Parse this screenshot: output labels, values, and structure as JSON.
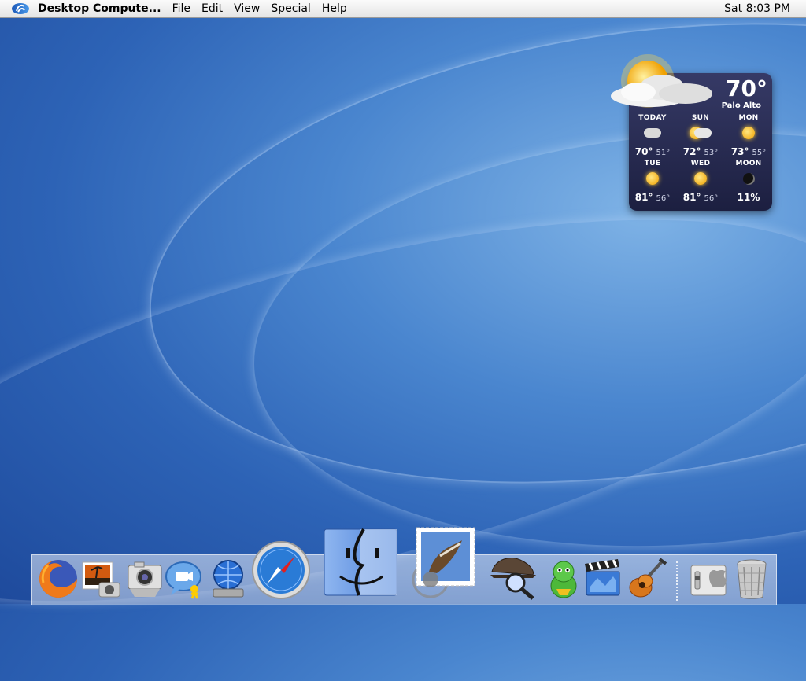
{
  "menubar": {
    "app_name": "Desktop Compute...",
    "menus": [
      "File",
      "Edit",
      "View",
      "Special",
      "Help"
    ],
    "clock": "Sat 8:03 PM"
  },
  "weather": {
    "current_temp": "70°",
    "city": "Palo Alto",
    "forecast": [
      {
        "day": "TODAY",
        "hi": "70°",
        "lo": "51°",
        "icon": "moon-cloud-icon"
      },
      {
        "day": "SUN",
        "hi": "72°",
        "lo": "53°",
        "icon": "partly-cloudy-icon"
      },
      {
        "day": "MON",
        "hi": "73°",
        "lo": "55°",
        "icon": "sun-icon"
      },
      {
        "day": "TUE",
        "hi": "81°",
        "lo": "56°",
        "icon": "sun-icon"
      },
      {
        "day": "WED",
        "hi": "81°",
        "lo": "56°",
        "icon": "sun-icon"
      },
      {
        "day": "MOON",
        "hi": "11%",
        "lo": "",
        "icon": "moon-phase-icon"
      }
    ]
  },
  "dock": {
    "apps": [
      "firefox-icon",
      "iphoto-icon",
      "image-capture-icon",
      "ichat-icon",
      "internet-connect-icon",
      "safari-icon",
      "finder-icon",
      "mail-icon",
      "sherlock-icon",
      "adium-icon",
      "imovie-icon",
      "garageband-icon",
      "system-preferences-icon",
      "trash-icon"
    ]
  },
  "colors": {
    "desktop": "#2d63b6",
    "widget": "#262a52",
    "accent": "#f0a000"
  }
}
